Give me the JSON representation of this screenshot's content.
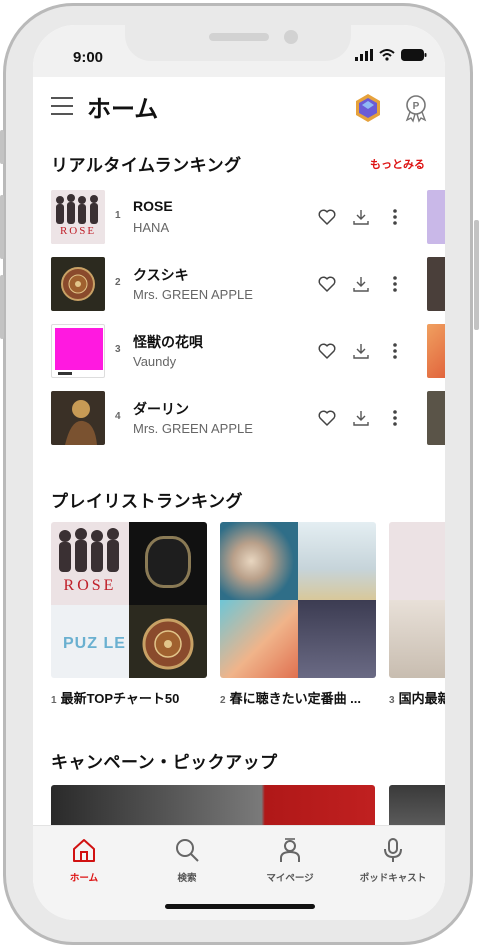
{
  "status": {
    "time": "9:00"
  },
  "header": {
    "title": "ホーム"
  },
  "realtime": {
    "title": "リアルタイムランキング",
    "more": "もっとみる",
    "items": [
      {
        "rank": "1",
        "song": "ROSE",
        "artist": "HANA"
      },
      {
        "rank": "2",
        "song": "クスシキ",
        "artist": "Mrs. GREEN APPLE"
      },
      {
        "rank": "3",
        "song": "怪獣の花唄",
        "artist": "Vaundy"
      },
      {
        "rank": "4",
        "song": "ダーリン",
        "artist": "Mrs. GREEN APPLE"
      }
    ]
  },
  "cover_text": {
    "rose": "ROSE",
    "puzzle": "PUZ LE"
  },
  "playlist": {
    "title": "プレイリストランキング",
    "items": [
      {
        "n": "1",
        "label": "最新TOPチャート50"
      },
      {
        "n": "2",
        "label": "春に聴きたい定番曲 ..."
      },
      {
        "n": "3",
        "label": "国内最新"
      }
    ]
  },
  "campaign": {
    "title": "キャンペーン・ピックアップ"
  },
  "tabs": [
    {
      "label": "ホーム",
      "icon": "home-icon"
    },
    {
      "label": "検索",
      "icon": "search-icon"
    },
    {
      "label": "マイページ",
      "icon": "user-icon"
    },
    {
      "label": "ポッドキャスト",
      "icon": "microphone-icon"
    }
  ],
  "colors": {
    "accent": "#d11111",
    "tab_bg": "#f4f4f4"
  }
}
